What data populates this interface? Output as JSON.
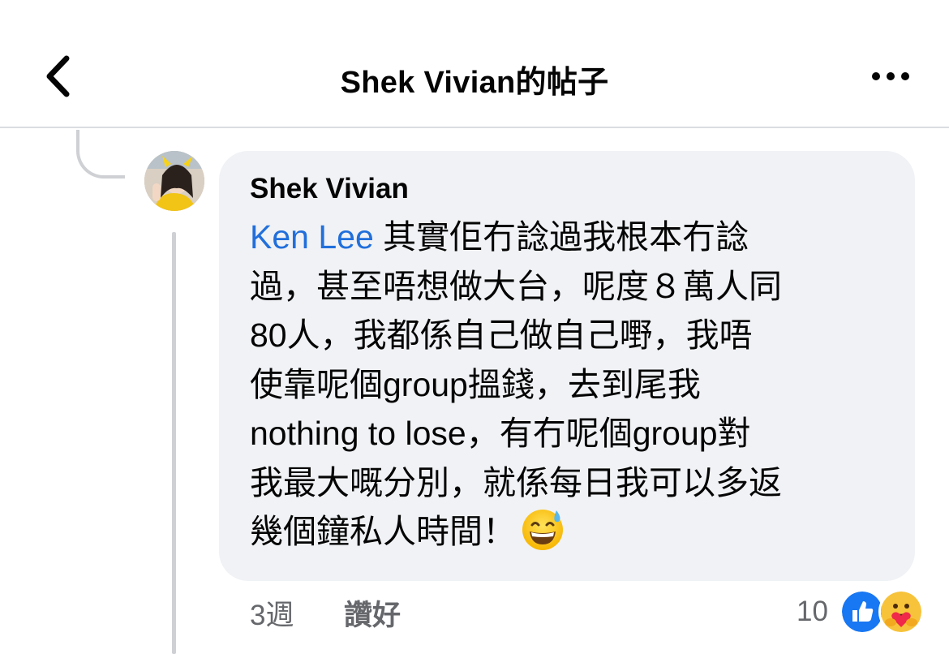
{
  "header": {
    "back_icon": "chevron-left-icon",
    "title": "Shek Vivian的帖子",
    "more_icon": "more-horizontal-icon"
  },
  "comment": {
    "author": "Shek Vivian",
    "mention": "Ken Lee",
    "lines": [
      " 其實佢冇諗過我根本冇諗",
      "過，甚至唔想做大台，呢度８萬人同",
      "80人，我都係自己做自己嘢，我唔",
      "使靠呢個group搵錢，去到尾我",
      "nothing to lose，有冇呢個group對",
      "我最大嘅分別，就係每日我可以多返",
      "幾個鐘私人時間！"
    ],
    "emoji": "grinning-face-with-sweat-emoji",
    "timestamp": "3週",
    "like_label": "讚好",
    "reaction_count": "10",
    "reaction_icons": [
      "like-reaction-icon",
      "care-reaction-icon"
    ]
  },
  "colors": {
    "mention": "#216fdb",
    "bubble": "#f0f2f5",
    "like_blue": "#1877f2",
    "meta_gray": "#65676b"
  }
}
